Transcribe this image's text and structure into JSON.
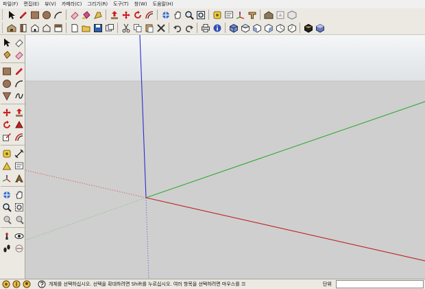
{
  "menubar": {
    "items": [
      "파일(F)",
      "편집(E)",
      "뷰(V)",
      "카메라(C)",
      "그리기(R)",
      "도구(T)",
      "창(W)",
      "도움말(H)"
    ]
  },
  "colors": {
    "axis_blue": "#2a2ad0",
    "axis_green": "#2fa82f",
    "axis_red": "#c02020",
    "ground": "#cfcfcf",
    "sky_top": "#f4f6f8",
    "sky_bottom": "#dfe3e6"
  },
  "toolbar1": {
    "icons": [
      "select-icon",
      "pencil-icon",
      "rectangle-icon",
      "circle-icon",
      "arc-icon",
      "eraser-icon",
      "paint-bucket-icon",
      "paint-tape-icon",
      "push-pull-icon",
      "move-icon",
      "rotate-icon",
      "offset-icon",
      "orbit-icon",
      "pan-icon",
      "zoom-icon",
      "zoom-extents-icon",
      "tape-measure-icon",
      "text-icon",
      "axes-icon",
      "3d-text-icon",
      "warehouse-icon",
      "share-model-icon",
      "components-icon"
    ]
  },
  "toolbar2": {
    "icons": [
      "get-models-icon",
      "door-icon",
      "cut-icon",
      "copy-icon",
      "paste-icon",
      "delete-icon",
      "undo-icon",
      "redo-icon",
      "print-icon",
      "model-info-icon",
      "iso-view-icon",
      "top-view-icon",
      "front-view-icon",
      "right-view-icon",
      "back-view-icon",
      "left-view-icon",
      "xray-icon",
      "shaded-icon"
    ]
  },
  "lefttools": {
    "icons": [
      "select-icon",
      "eraser-icon",
      "paint-bucket-icon",
      "rectangle-icon",
      "pencil-icon",
      "circle-icon",
      "arc-icon",
      "polygon-icon",
      "freehand-icon",
      "move-icon",
      "push-pull-icon",
      "rotate-icon",
      "follow-me-icon",
      "scale-icon",
      "offset-icon",
      "tape-measure-icon",
      "dimension-icon",
      "protractor-icon",
      "text-icon",
      "axes-icon",
      "3d-text-icon",
      "orbit-icon",
      "pan-icon",
      "zoom-icon",
      "zoom-window-icon",
      "zoom-extents-icon",
      "previous-view-icon",
      "position-camera-icon",
      "look-around-icon",
      "walk-icon",
      "section-plane-icon"
    ]
  },
  "status": {
    "text": "개체를 선택하십시오. 선택을 확대하려면 Shift를 누르십시오. 여러 항목을 선택하려면 마우스를 끄",
    "measure_label": "단위"
  }
}
